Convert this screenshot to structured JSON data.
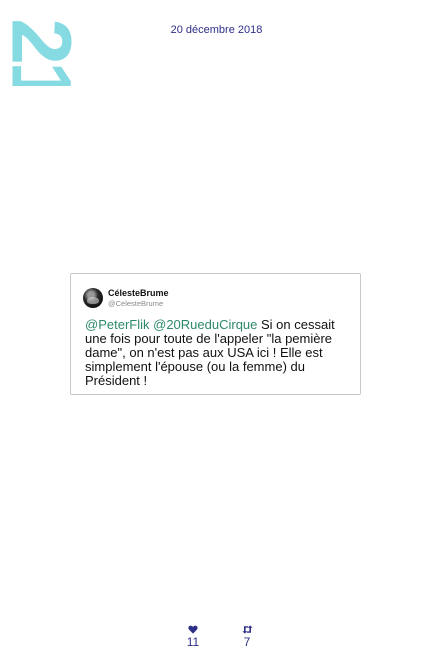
{
  "page": {
    "side_number": "21",
    "date": "20 décembre 2018"
  },
  "tweet": {
    "display_name": "CélesteBrume",
    "handle": "@CelesteBrume",
    "mentions": [
      "@PeterFlik",
      "@20RueduCirque"
    ],
    "text": "Si on cessait une fois pour toute de l'appeler \"la pemière dame\", on n'est pas aux USA ici ! Elle est simplement l'épouse (ou la femme) du Président !"
  },
  "stats": {
    "likes": "11",
    "retweets": "7"
  },
  "icons": {
    "likes": "heart-icon",
    "retweets": "retweet-icon"
  },
  "colors": {
    "side_number": "#86dbe2",
    "date": "#2e2f86",
    "mention": "#2c8a6a",
    "stats": "#2e2f86"
  }
}
